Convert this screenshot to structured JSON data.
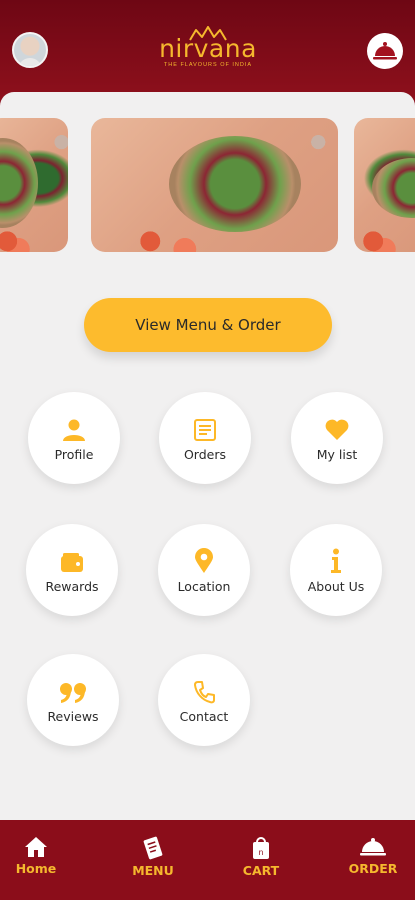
{
  "header": {
    "brand_name": "nirvana",
    "tagline": "THE FLAVOURS OF INDIA",
    "brand_color": "#f5b82e",
    "background_color": "#8b0d1a"
  },
  "hero": {
    "cta_label": "View Menu & Order",
    "cta_color": "#fdbb2d"
  },
  "tiles": [
    {
      "label": "Profile",
      "icon": "person-icon"
    },
    {
      "label": "Orders",
      "icon": "receipt-icon"
    },
    {
      "label": "My list",
      "icon": "heart-icon"
    },
    {
      "label": "Rewards",
      "icon": "wallet-icon"
    },
    {
      "label": "Location",
      "icon": "map-pin-icon"
    },
    {
      "label": "About Us",
      "icon": "info-icon"
    },
    {
      "label": "Reviews",
      "icon": "quote-icon"
    },
    {
      "label": "Contact",
      "icon": "phone-icon"
    }
  ],
  "tabbar": {
    "items": [
      {
        "label": "Home",
        "icon": "home-icon"
      },
      {
        "label": "MENU",
        "icon": "menu-card-icon"
      },
      {
        "label": "CART",
        "icon": "cart-bag-icon"
      },
      {
        "label": "ORDER",
        "icon": "cloche-icon"
      }
    ]
  }
}
